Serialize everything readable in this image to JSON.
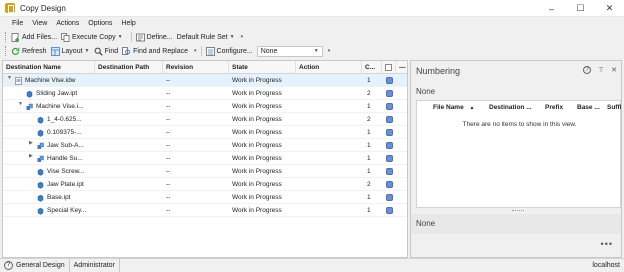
{
  "window": {
    "title": "Copy Design",
    "minimize": "–",
    "maximize": "☐",
    "close": "✕"
  },
  "menu": [
    "File",
    "View",
    "Actions",
    "Options",
    "Help"
  ],
  "toolbar1": {
    "add_files": "Add Files...",
    "execute_copy": "Execute Copy",
    "define": "Define...",
    "rule_set": "Default Rule Set"
  },
  "toolbar2": {
    "refresh": "Refresh",
    "layout": "Layout",
    "find": "Find",
    "find_replace": "Find and Replace",
    "configure": "Configure...",
    "config_value": "None"
  },
  "grid": {
    "columns": [
      "Destination Name",
      "Destination Path",
      "Revision",
      "State",
      "Action",
      "C...",
      ""
    ],
    "rows": [
      {
        "name": "Machine Vise.idw",
        "path": "",
        "revision": "--",
        "state": "Work in Progress",
        "action": "",
        "count": "1",
        "level": 0,
        "expander": "▼",
        "kind": "idw",
        "selected": true
      },
      {
        "name": "Sliding Jaw.ipt",
        "path": "",
        "revision": "--",
        "state": "Work in Progress",
        "action": "",
        "count": "2",
        "level": 1,
        "expander": "",
        "kind": "ipt",
        "selected": false
      },
      {
        "name": "Machine Vise.i...",
        "path": "",
        "revision": "--",
        "state": "Work in Progress",
        "action": "",
        "count": "1",
        "level": 1,
        "expander": "▼",
        "kind": "iam",
        "selected": false
      },
      {
        "name": "1_4-0.625...",
        "path": "",
        "revision": "--",
        "state": "Work in Progress",
        "action": "",
        "count": "2",
        "level": 2,
        "expander": "",
        "kind": "ipt",
        "selected": false
      },
      {
        "name": "0.109375-...",
        "path": "",
        "revision": "--",
        "state": "Work in Progress",
        "action": "",
        "count": "1",
        "level": 2,
        "expander": "",
        "kind": "ipt",
        "selected": false
      },
      {
        "name": "Jaw Sub-A...",
        "path": "",
        "revision": "--",
        "state": "Work in Progress",
        "action": "",
        "count": "1",
        "level": 2,
        "expander": "▶",
        "kind": "iam",
        "selected": false
      },
      {
        "name": "Handle Su...",
        "path": "",
        "revision": "--",
        "state": "Work in Progress",
        "action": "",
        "count": "1",
        "level": 2,
        "expander": "▶",
        "kind": "iam",
        "selected": false
      },
      {
        "name": "Vise Screw...",
        "path": "",
        "revision": "--",
        "state": "Work in Progress",
        "action": "",
        "count": "1",
        "level": 2,
        "expander": "",
        "kind": "ipt",
        "selected": false
      },
      {
        "name": "Jaw Plate.ipt",
        "path": "",
        "revision": "--",
        "state": "Work in Progress",
        "action": "",
        "count": "2",
        "level": 2,
        "expander": "",
        "kind": "ipt",
        "selected": false
      },
      {
        "name": "Base.ipt",
        "path": "",
        "revision": "--",
        "state": "Work in Progress",
        "action": "",
        "count": "1",
        "level": 2,
        "expander": "",
        "kind": "ipt",
        "selected": false
      },
      {
        "name": "Special Key...",
        "path": "",
        "revision": "--",
        "state": "Work in Progress",
        "action": "",
        "count": "1",
        "level": 2,
        "expander": "",
        "kind": "ipt",
        "selected": false
      }
    ]
  },
  "numbering": {
    "title": "Numbering",
    "help": "?",
    "pin": "⊤",
    "close": "✕",
    "none_top": "None",
    "columns": [
      "File Name",
      "Destination ...",
      "Prefix",
      "Base ...",
      "Suffi"
    ],
    "sort_indicator": "▲",
    "empty_message": "There are no items to show in this view.",
    "none_bottom": "None",
    "more": "•••"
  },
  "status": {
    "workspace": "General Design",
    "user": "Administrator",
    "server": "localhost"
  },
  "colors": {
    "selected_row": "#e5f1fb",
    "status_blue": "#6b8fd6",
    "ipt_icon": "#3d7cc9",
    "folder": "#e8b84a"
  }
}
